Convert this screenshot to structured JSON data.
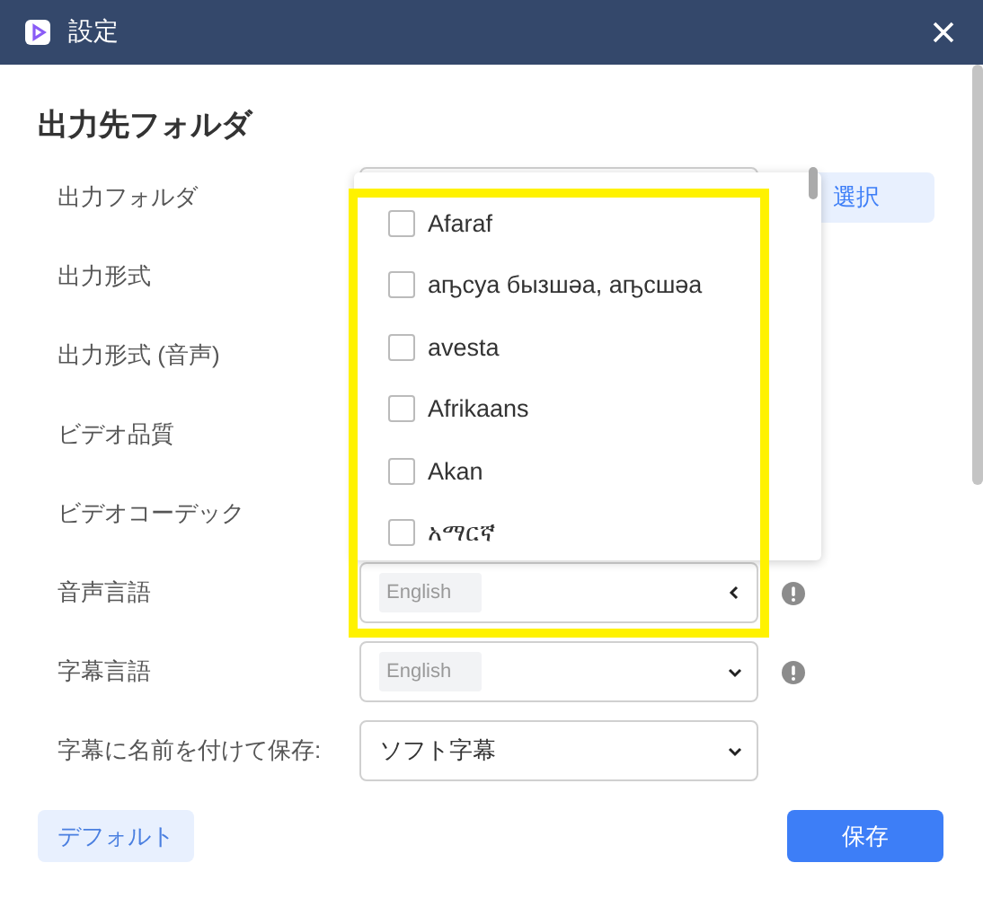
{
  "window": {
    "title": "設定"
  },
  "section_title": "出力先フォルダ",
  "rows": [
    {
      "label": "出力フォルダ",
      "kind": "folder",
      "button": "選択"
    },
    {
      "label": "出力形式",
      "kind": "hidden"
    },
    {
      "label": "出力形式 (音声)",
      "kind": "hidden"
    },
    {
      "label": "ビデオ品質",
      "kind": "hidden"
    },
    {
      "label": "ビデオコーデック",
      "kind": "hidden"
    },
    {
      "label": "音声言語",
      "kind": "tags",
      "tag": "English",
      "expanded": true,
      "info": true,
      "options": [
        {
          "label": "Afaraf",
          "checked": false
        },
        {
          "label": "аҧсуа бызшәа, аҧсшәа",
          "checked": false
        },
        {
          "label": "avesta",
          "checked": false
        },
        {
          "label": "Afrikaans",
          "checked": false
        },
        {
          "label": "Akan",
          "checked": false
        },
        {
          "label": "አማርኛ",
          "checked": false
        }
      ]
    },
    {
      "label": "字幕言語",
      "kind": "tags",
      "tag": "English",
      "expanded": false,
      "info": true
    },
    {
      "label": "字幕に名前を付けて保存:",
      "kind": "select",
      "value": "ソフト字幕",
      "expanded": false
    }
  ],
  "buttons": {
    "default": "デフォルト",
    "save": "保存"
  }
}
